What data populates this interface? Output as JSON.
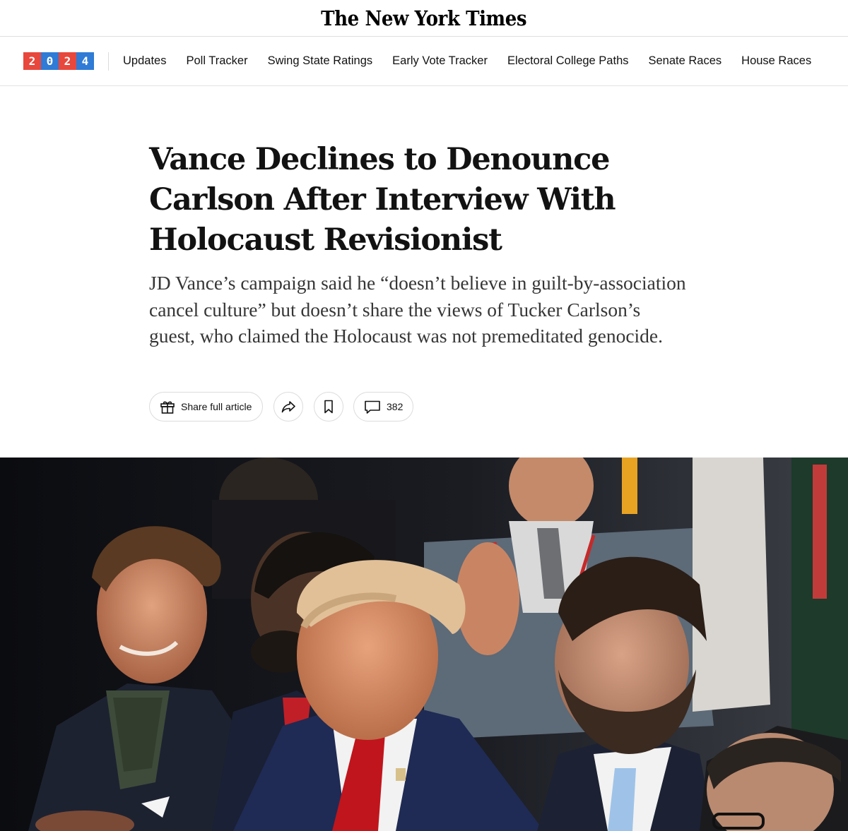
{
  "masthead": {
    "logo_text": "The New York Times"
  },
  "election_nav": {
    "year_digits": [
      {
        "digit": "2",
        "color": "#e8473c"
      },
      {
        "digit": "0",
        "color": "#2f7bd6"
      },
      {
        "digit": "2",
        "color": "#e8473c"
      },
      {
        "digit": "4",
        "color": "#2f7bd6"
      }
    ],
    "links": [
      "Updates",
      "Poll Tracker",
      "Swing State Ratings",
      "Early Vote Tracker",
      "Electoral College Paths",
      "Senate Races",
      "House Races"
    ]
  },
  "article": {
    "headline": "Vance Declines to Denounce Carlson After Interview With Holocaust Revisionist",
    "summary": "JD Vance’s campaign said he “doesn’t believe in guilt-by-association cancel culture” but doesn’t share the views of Tucker Carlson’s guest, who claimed the Holocaust was not premeditated genocide."
  },
  "actions": {
    "share_full_label": "Share full article",
    "share_icon": "share-arrow-icon",
    "save_icon": "bookmark-icon",
    "comments_icon": "comment-bubble-icon",
    "comments_count": "382"
  },
  "photo": {
    "subject": "lead-photo"
  }
}
